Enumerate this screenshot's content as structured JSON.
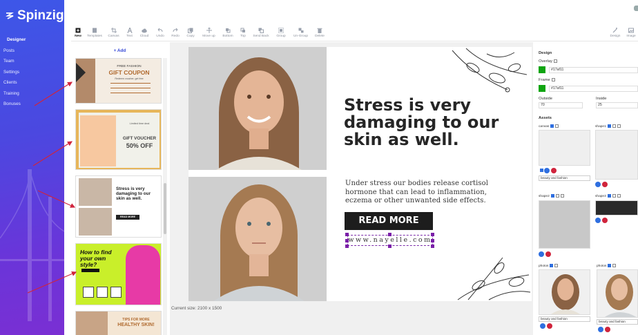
{
  "sidebar": {
    "brand": "Spinzign",
    "items": [
      {
        "label": "Designer",
        "active": true
      },
      {
        "label": "Posts"
      },
      {
        "label": "Team"
      },
      {
        "label": "Settings"
      },
      {
        "label": "Clients"
      },
      {
        "label": "Training"
      },
      {
        "label": "Bonuses"
      }
    ]
  },
  "toolbar": {
    "tools": [
      "New",
      "Templates",
      "Canvas",
      "Text",
      "Cloud",
      "Undo",
      "Redo",
      "Copy",
      "Move up",
      "Bottom",
      "Top",
      "Send Back",
      "Group",
      "Un-Group",
      "Delete"
    ],
    "right_tools": [
      "Design",
      "Image"
    ]
  },
  "templates": {
    "add_label": "+ Add",
    "items": [
      {
        "top": "FREE FASHION",
        "main": "GIFT COUPON",
        "sub": "Redeem voucher, get free"
      },
      {
        "top": "Limited time deal",
        "main": "GIFT VOUCHER",
        "sub": "50% OFF"
      },
      {
        "top": "",
        "main": "Stress is very damaging to our skin as well.",
        "sub": "READ MORE"
      },
      {
        "top": "How to find your own style?",
        "main": "",
        "sub": ""
      },
      {
        "top": "TIPS FOR MORE",
        "main": "HEALTHY SKIN!",
        "sub": ""
      }
    ]
  },
  "canvas": {
    "headline": "Stress is very damaging to our skin as well.",
    "body": "Under stress our bodies release cortisol hormone that can lead to inflammation, eczema or other unwanted side effects.",
    "button": "READ MORE",
    "website": "www.nayelle.com",
    "size_label": "Current size: 2100 x 1500"
  },
  "right_panel": {
    "design_label": "Design",
    "overlay_label": "Overlay",
    "overlay_color": "#17af11",
    "frame_label": "Frame",
    "frame_color": "#17af11",
    "outside_label": "Outside",
    "outside_value": "70",
    "inside_label": "Inside",
    "inside_value": "25",
    "assets_label": "Assets",
    "asset1_label": "canvas",
    "asset2_label": "shape1",
    "asset3_label": "shape2",
    "asset4_label": "shape3",
    "asset5_label": "photos",
    "asset6_label": "photos",
    "select1": "beauty and fashion",
    "select2": "beauty and fashion",
    "select3": "beauty and fashion"
  },
  "colors": {
    "accent": "#3447d6",
    "swatch": "#0fa511",
    "arrow": "#d0243c"
  }
}
